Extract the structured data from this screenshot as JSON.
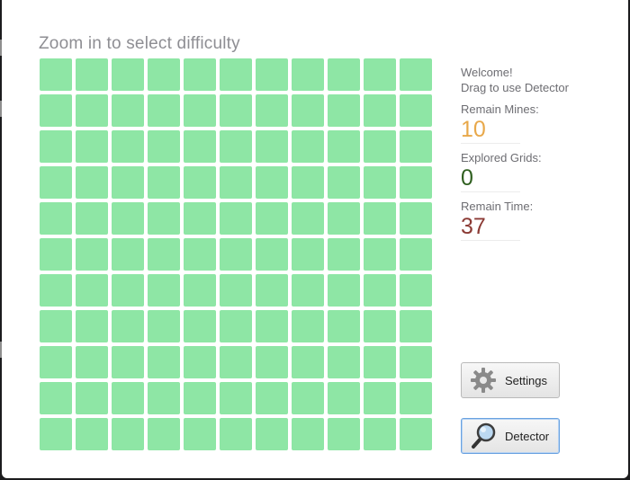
{
  "header": {
    "title": "Zoom in to select difficulty"
  },
  "board": {
    "rows": 11,
    "cols": 11,
    "cell_color": "#8ee6a5"
  },
  "sidebar": {
    "welcome_line1": "Welcome!",
    "welcome_line2": "Drag to use Detector",
    "remain_mines_label": "Remain Mines:",
    "remain_mines_value": "10",
    "explored_label": "Explored Grids:",
    "explored_value": "0",
    "remain_time_label": "Remain Time:",
    "remain_time_value": "37"
  },
  "colors": {
    "mines": "#e8a84a",
    "explored": "#2f5f1f",
    "time": "#8b3a34"
  },
  "buttons": {
    "settings_label": "Settings",
    "settings_icon": "gear-icon",
    "detector_label": "Detector",
    "detector_icon": "magnifier-icon"
  }
}
